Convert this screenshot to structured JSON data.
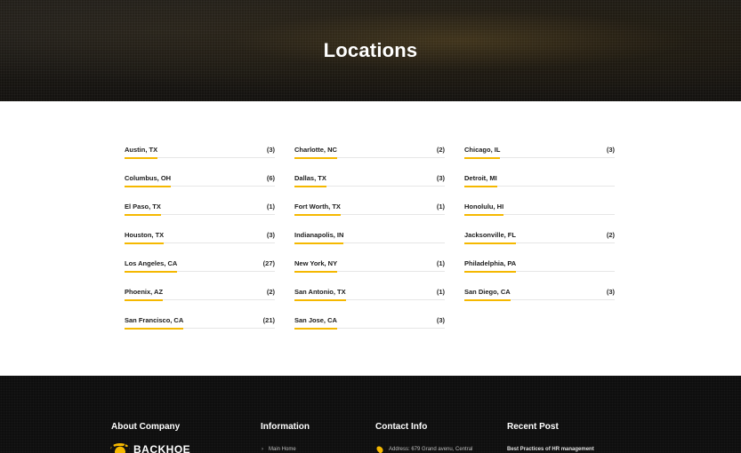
{
  "hero": {
    "title": "Locations"
  },
  "locations": [
    {
      "name": "Austin, TX",
      "count": "(3)"
    },
    {
      "name": "Charlotte, NC",
      "count": "(2)"
    },
    {
      "name": "Chicago, IL",
      "count": "(3)"
    },
    {
      "name": "Columbus, OH",
      "count": "(6)"
    },
    {
      "name": "Dallas, TX",
      "count": "(3)"
    },
    {
      "name": "Detroit, MI",
      "count": ""
    },
    {
      "name": "El Paso, TX",
      "count": "(1)"
    },
    {
      "name": "Fort Worth, TX",
      "count": "(1)"
    },
    {
      "name": "Honolulu, HI",
      "count": ""
    },
    {
      "name": "Houston, TX",
      "count": "(3)"
    },
    {
      "name": "Indianapolis, IN",
      "count": ""
    },
    {
      "name": "Jacksonville, FL",
      "count": "(2)"
    },
    {
      "name": "Los Angeles, CA",
      "count": "(27)"
    },
    {
      "name": "New York, NY",
      "count": "(1)"
    },
    {
      "name": "Philadelphia, PA",
      "count": ""
    },
    {
      "name": "Phoenix, AZ",
      "count": "(2)"
    },
    {
      "name": "San Antonio, TX",
      "count": "(1)"
    },
    {
      "name": "San Diego, CA",
      "count": "(3)"
    },
    {
      "name": "San Francisco, CA",
      "count": "(21)"
    },
    {
      "name": "San Jose, CA",
      "count": "(3)"
    }
  ],
  "footer": {
    "about_heading": "About Company",
    "logo_text": "BACKHOE",
    "information_heading": "Information",
    "information_first_link": "Main Home",
    "contact_heading": "Contact Info",
    "contact_address": "Address: 679 Grand avenu, Central",
    "recent_heading": "Recent Post",
    "recent_first_post": "Best Practices of HR management"
  },
  "colors": {
    "accent": "#f5b800",
    "hero_bg": "#1a1814",
    "footer_bg": "#0e0e0e"
  },
  "icons": {
    "address": "map-pin-icon",
    "link": "chevron-right-icon",
    "logo": "logo-mark-icon"
  }
}
